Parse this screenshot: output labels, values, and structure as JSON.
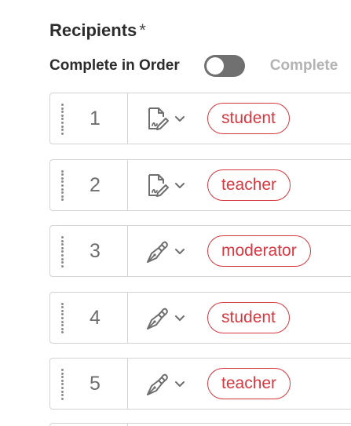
{
  "header": {
    "title": "Recipients",
    "required_mark": "*"
  },
  "order": {
    "label": "Complete in Order",
    "toggle_on": false,
    "other_label": "Complete"
  },
  "colors": {
    "accent_red": "#d7373f",
    "toggle_off": "#707070",
    "border": "#d3d3d3"
  },
  "recipients": [
    {
      "number": "1",
      "role_icon": "form-fill-icon",
      "role": "student"
    },
    {
      "number": "2",
      "role_icon": "form-fill-icon",
      "role": "teacher"
    },
    {
      "number": "3",
      "role_icon": "pen-sign-icon",
      "role": "moderator"
    },
    {
      "number": "4",
      "role_icon": "pen-sign-icon",
      "role": "student"
    },
    {
      "number": "5",
      "role_icon": "pen-sign-icon",
      "role": "teacher"
    }
  ]
}
